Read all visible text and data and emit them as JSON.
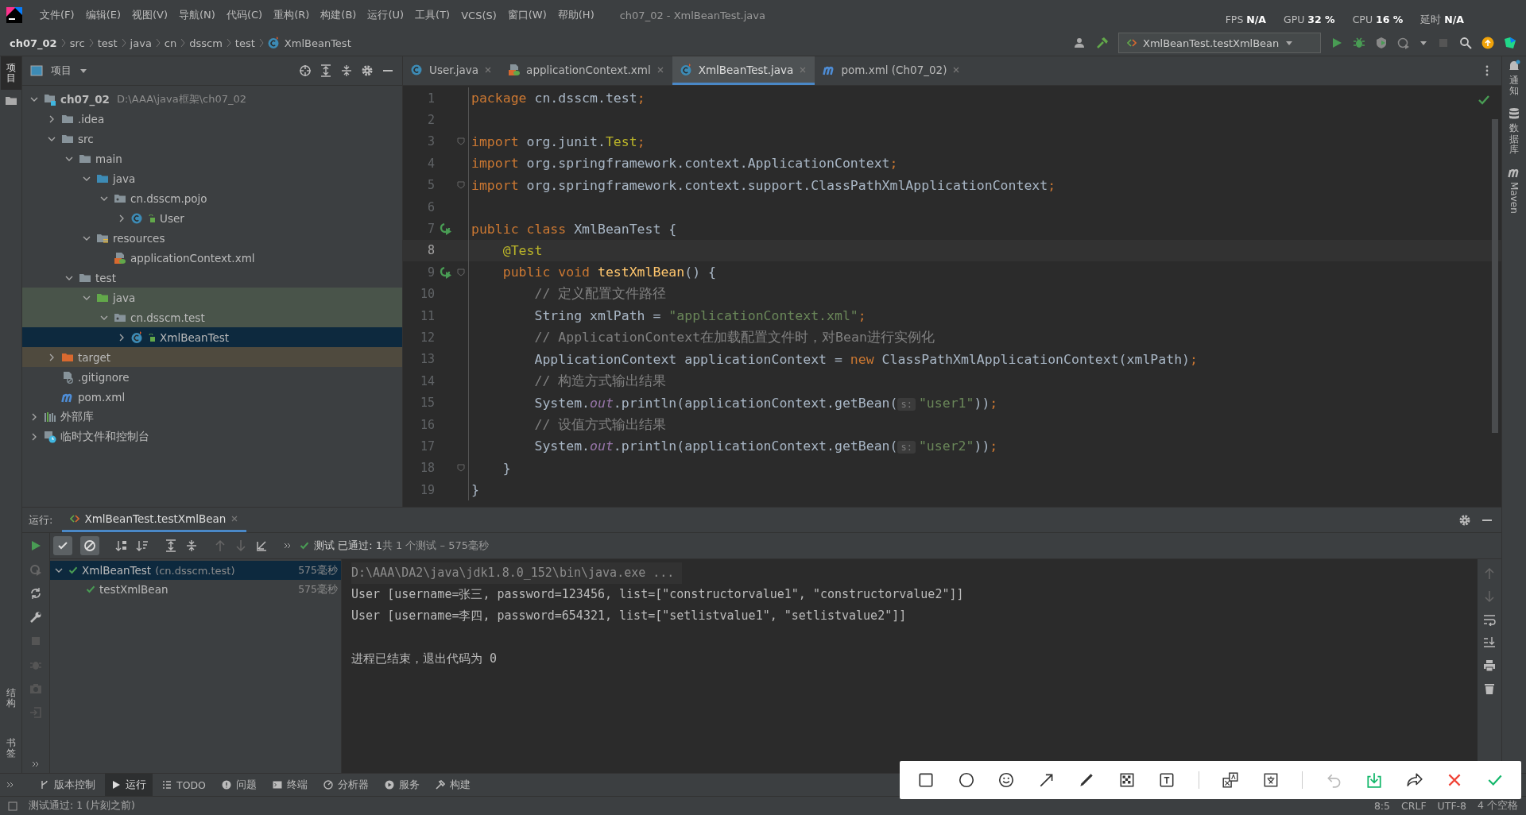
{
  "menu_bar": {
    "menus": [
      "文件(F)",
      "编辑(E)",
      "视图(V)",
      "导航(N)",
      "代码(C)",
      "重构(R)",
      "构建(B)",
      "运行(U)",
      "工具(T)",
      "VCS(S)",
      "窗口(W)",
      "帮助(H)"
    ],
    "title": "ch07_02 - XmlBeanTest.java",
    "stats": [
      {
        "label": "FPS",
        "value": "N/A"
      },
      {
        "label": "GPU",
        "value": "32 %"
      },
      {
        "label": "CPU",
        "value": "16 %"
      },
      {
        "label": "延时",
        "value": "N/A"
      }
    ]
  },
  "navigation_bar": {
    "breadcrumbs": [
      "ch07_02",
      "src",
      "test",
      "java",
      "cn",
      "dsscm",
      "test",
      "XmlBeanTest"
    ],
    "run_configuration": "XmlBeanTest.testXmlBean"
  },
  "left_stripe": {
    "top": [
      {
        "label": "项目",
        "selected": true
      }
    ],
    "bottom": [
      {
        "label": "结构"
      },
      {
        "label": "书签"
      }
    ]
  },
  "project_panel": {
    "title": "项目",
    "tree": [
      {
        "label": "ch07_02",
        "path": "D:\\AAA\\java框架\\ch07_02",
        "kind": "module",
        "expanded": true,
        "selected": false,
        "children": [
          {
            "label": ".idea",
            "kind": "folder",
            "expanded": false,
            "selected": false
          },
          {
            "label": "src",
            "kind": "folder",
            "expanded": true,
            "selected": false,
            "children": [
              {
                "label": "main",
                "kind": "folder",
                "expanded": true,
                "selected": false,
                "children": [
                  {
                    "label": "java",
                    "kind": "source-root",
                    "expanded": true,
                    "selected": false,
                    "children": [
                      {
                        "label": "cn.dsscm.pojo",
                        "kind": "package",
                        "expanded": true,
                        "selected": false,
                        "children": [
                          {
                            "label": "User",
                            "kind": "class",
                            "expanded": false,
                            "selected": false
                          }
                        ]
                      }
                    ]
                  },
                  {
                    "label": "resources",
                    "kind": "resources",
                    "expanded": true,
                    "selected": false,
                    "children": [
                      {
                        "label": "applicationContext.xml",
                        "kind": "xml",
                        "selected": false
                      }
                    ]
                  }
                ]
              },
              {
                "label": "test",
                "kind": "folder",
                "expanded": true,
                "selected": false,
                "children": [
                  {
                    "label": "java",
                    "kind": "test-root",
                    "test_source": true,
                    "expanded": true,
                    "selected": false,
                    "children": [
                      {
                        "label": "cn.dsscm.test",
                        "kind": "package",
                        "test_source": true,
                        "expanded": true,
                        "selected": false,
                        "children": [
                          {
                            "label": "XmlBeanTest",
                            "kind": "test-class",
                            "expanded": false,
                            "selected": true
                          }
                        ]
                      }
                    ]
                  }
                ]
              }
            ]
          },
          {
            "label": "target",
            "kind": "excluded",
            "excluded": true,
            "expanded": false,
            "selected": false
          },
          {
            "label": ".gitignore",
            "kind": "ignore-file",
            "selected": false
          },
          {
            "label": "pom.xml",
            "kind": "maven",
            "selected": false
          }
        ]
      },
      {
        "label": "外部库",
        "kind": "library",
        "expanded": false,
        "selected": false
      },
      {
        "label": "临时文件和控制台",
        "kind": "scratch",
        "expanded": false,
        "selected": false
      }
    ]
  },
  "editor": {
    "tabs": [
      {
        "label": "User.java",
        "kind": "class",
        "selected": false
      },
      {
        "label": "applicationContext.xml",
        "kind": "xml",
        "selected": false
      },
      {
        "label": "XmlBeanTest.java",
        "kind": "test-class",
        "selected": true
      },
      {
        "label": "pom.xml (Ch07_02)",
        "kind": "maven",
        "selected": false
      }
    ],
    "lines": [
      {
        "number": "1",
        "tokens": [
          {
            "kind": "kw",
            "text": "package"
          },
          {
            "kind": "plain",
            "text": " cn.dsscm.test"
          },
          {
            "kind": "kw",
            "text": ";"
          }
        ]
      },
      {
        "number": "2"
      },
      {
        "number": "3",
        "fold": true,
        "tokens": [
          {
            "kind": "kw",
            "text": "import"
          },
          {
            "kind": "plain",
            "text": " org.junit."
          },
          {
            "kind": "ann",
            "text": "Test"
          },
          {
            "kind": "kw",
            "text": ";"
          }
        ]
      },
      {
        "number": "4",
        "tokens": [
          {
            "kind": "kw",
            "text": "import"
          },
          {
            "kind": "plain",
            "text": " org.springframework.context.ApplicationContext"
          },
          {
            "kind": "kw",
            "text": ";"
          }
        ]
      },
      {
        "number": "5",
        "fold": true,
        "tokens": [
          {
            "kind": "kw",
            "text": "import"
          },
          {
            "kind": "plain",
            "text": " org.springframework.context.support.ClassPathXmlApplicationContext"
          },
          {
            "kind": "kw",
            "text": ";"
          }
        ]
      },
      {
        "number": "6"
      },
      {
        "number": "7",
        "run": true,
        "tokens": [
          {
            "kind": "kw",
            "text": "public class "
          },
          {
            "kind": "plain",
            "text": "XmlBeanTest {"
          }
        ]
      },
      {
        "number": "8",
        "current": true,
        "tokens": [
          {
            "kind": "ann",
            "text": "    @Test"
          }
        ]
      },
      {
        "number": "9",
        "run": true,
        "fold": true,
        "tokens": [
          {
            "kind": "kw",
            "text": "    public void "
          },
          {
            "kind": "fn",
            "text": "testXmlBean"
          },
          {
            "kind": "plain",
            "text": "() {"
          }
        ]
      },
      {
        "number": "10",
        "tokens": [
          {
            "kind": "comment",
            "text": "        // 定义配置文件路径"
          }
        ]
      },
      {
        "number": "11",
        "tokens": [
          {
            "kind": "plain",
            "text": "        String xmlPath = "
          },
          {
            "kind": "str",
            "text": "\"applicationContext.xml\""
          },
          {
            "kind": "kw",
            "text": ";"
          }
        ]
      },
      {
        "number": "12",
        "tokens": [
          {
            "kind": "comment",
            "text": "        // ApplicationContext在加载配置文件时，对Bean进行实例化"
          }
        ]
      },
      {
        "number": "13",
        "tokens": [
          {
            "kind": "plain",
            "text": "        ApplicationContext applicationContext = "
          },
          {
            "kind": "kw",
            "text": "new "
          },
          {
            "kind": "plain",
            "text": "ClassPathXmlApplicationContext(xmlPath)"
          },
          {
            "kind": "kw",
            "text": ";"
          }
        ]
      },
      {
        "number": "14",
        "tokens": [
          {
            "kind": "comment",
            "text": "        // 构造方式输出结果"
          }
        ]
      },
      {
        "number": "15",
        "tokens": [
          {
            "kind": "plain",
            "text": "        System."
          },
          {
            "kind": "field",
            "text": "out"
          },
          {
            "kind": "plain",
            "text": ".println(applicationContext.getBean("
          },
          {
            "kind": "hint",
            "text": "s:"
          },
          {
            "kind": "str",
            "text": "\"user1\""
          },
          {
            "kind": "plain",
            "text": "))"
          },
          {
            "kind": "kw",
            "text": ";"
          }
        ]
      },
      {
        "number": "16",
        "tokens": [
          {
            "kind": "comment",
            "text": "        // 设值方式输出结果"
          }
        ]
      },
      {
        "number": "17",
        "tokens": [
          {
            "kind": "plain",
            "text": "        System."
          },
          {
            "kind": "field",
            "text": "out"
          },
          {
            "kind": "plain",
            "text": ".println(applicationContext.getBean("
          },
          {
            "kind": "hint",
            "text": "s:"
          },
          {
            "kind": "str",
            "text": "\"user2\""
          },
          {
            "kind": "plain",
            "text": "))"
          },
          {
            "kind": "kw",
            "text": ";"
          }
        ]
      },
      {
        "number": "18",
        "fold": true,
        "tokens": [
          {
            "kind": "plain",
            "text": "    }"
          }
        ]
      },
      {
        "number": "19",
        "tokens": [
          {
            "kind": "plain",
            "text": "}"
          }
        ]
      }
    ]
  },
  "right_stripe": [
    {
      "label": "通知",
      "kind": "bell"
    },
    {
      "label": "数据库",
      "kind": "database"
    },
    {
      "label": "Maven",
      "kind": "maven"
    }
  ],
  "run_panel": {
    "label": "运行:",
    "tab": "XmlBeanTest.testXmlBean",
    "status_passed": "测试 已通过: 1",
    "status_detail": "共 1 个测试 – 575毫秒",
    "tests": [
      {
        "name": "XmlBeanTest",
        "detail": "(cn.dsscm.test)",
        "time": "575毫秒",
        "passed": true,
        "expanded": true,
        "selected": true,
        "children": [
          {
            "name": "testXmlBean",
            "time": "575毫秒",
            "passed": true,
            "selected": false
          }
        ]
      }
    ],
    "console": [
      {
        "kind": "command",
        "text": "D:\\AAA\\DA2\\java\\jdk1.8.0_152\\bin\\java.exe ..."
      },
      {
        "kind": "output",
        "text": "User [username=张三, password=123456, list=[\"constructorvalue1\", \"constructorvalue2\"]]"
      },
      {
        "kind": "output",
        "text": "User [username=李四, password=654321, list=[\"setlistvalue1\", \"setlistvalue2\"]]"
      },
      {
        "kind": "exit",
        "text": "进程已结束，退出代码为 0"
      }
    ]
  },
  "tool_tabs": [
    {
      "label": "版本控制",
      "kind": "branch",
      "selected": false
    },
    {
      "label": "运行",
      "kind": "play",
      "selected": true
    },
    {
      "label": "TODO",
      "kind": "list",
      "selected": false
    },
    {
      "label": "问题",
      "kind": "alert",
      "selected": false
    },
    {
      "label": "终端",
      "kind": "terminal",
      "selected": false
    },
    {
      "label": "分析器",
      "kind": "gauge",
      "selected": false
    },
    {
      "label": "服务",
      "kind": "play-circle",
      "selected": false
    },
    {
      "label": "构建",
      "kind": "hammer",
      "selected": false
    }
  ],
  "status_bar": {
    "message": "测试通过: 1 (片刻之前)",
    "items": [
      "8:5",
      "CRLF",
      "UTF-8",
      "4 个空格"
    ]
  }
}
